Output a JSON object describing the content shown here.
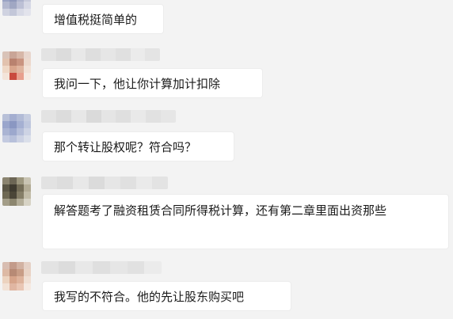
{
  "messages": [
    {
      "text": "增值税挺简单的"
    },
    {
      "text": "我问一下，他让你计算加计扣除"
    },
    {
      "text": "那个转让股权呢？符合吗？"
    },
    {
      "text": "解答题考了融资租赁合同所得税计算，还有第二章里面出资那些"
    },
    {
      "text": "我写的不符合。他的先让股东购买吧"
    }
  ]
}
